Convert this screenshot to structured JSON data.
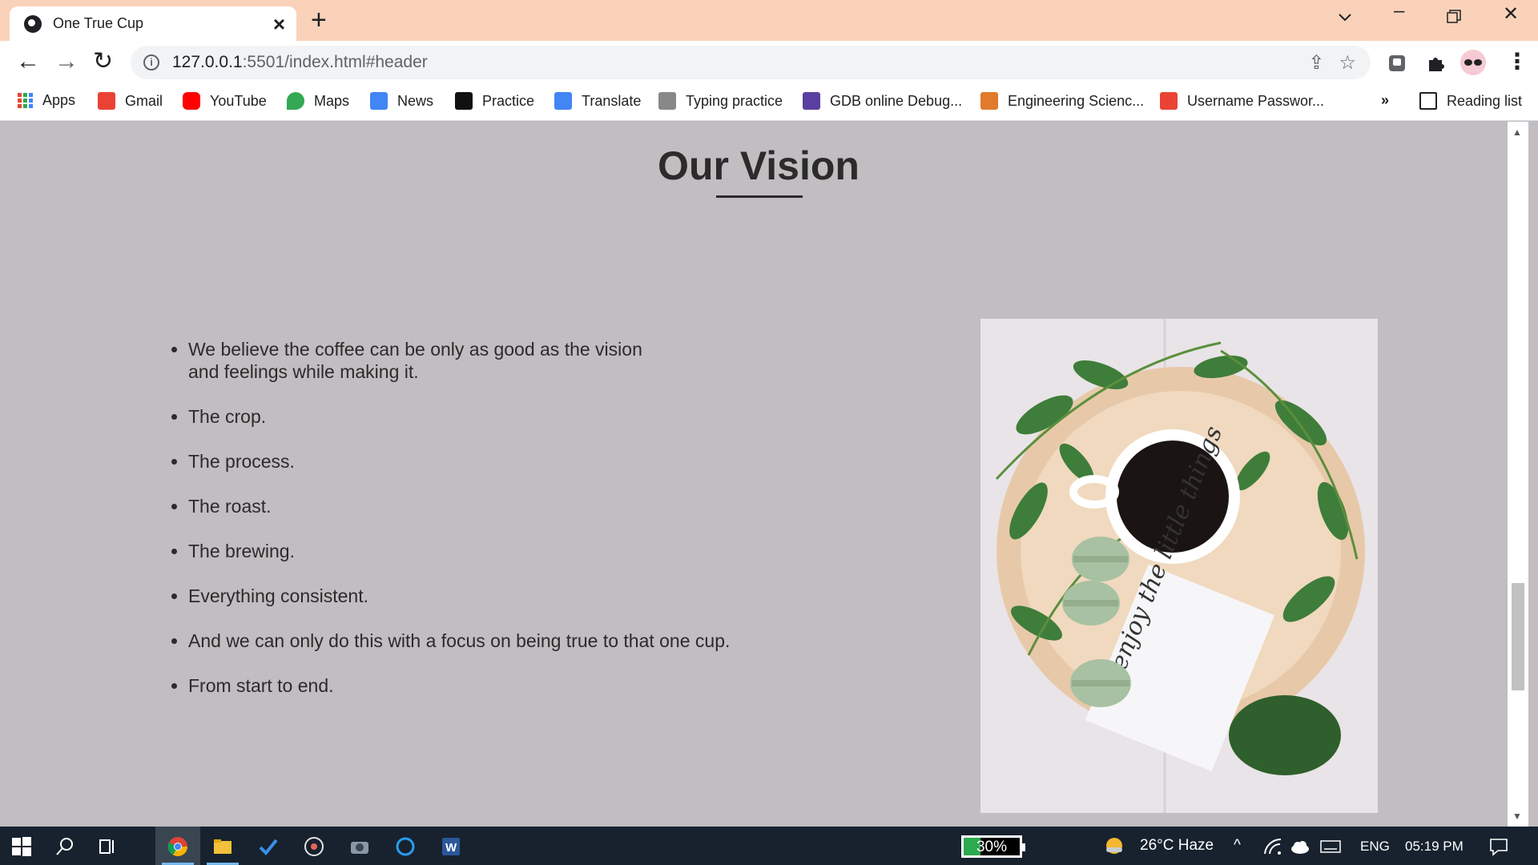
{
  "browser": {
    "tab_title": "One True Cup",
    "new_tab": "+",
    "url_host": "127.0.0.1",
    "url_rest": ":5501/index.html#header"
  },
  "bookmarks": [
    {
      "label": "Apps",
      "icon": "apps-grid-icon",
      "color": "#4285f4"
    },
    {
      "label": "Gmail",
      "icon": "gmail-icon",
      "color": "#ea4335"
    },
    {
      "label": "YouTube",
      "icon": "youtube-icon",
      "color": "#ff0000"
    },
    {
      "label": "Maps",
      "icon": "maps-icon",
      "color": "#34a853"
    },
    {
      "label": "News",
      "icon": "news-icon",
      "color": "#4285f4"
    },
    {
      "label": "Practice",
      "icon": "practice-icon",
      "color": "#111111"
    },
    {
      "label": "Translate",
      "icon": "translate-icon",
      "color": "#4285f4"
    },
    {
      "label": "Typing practice",
      "icon": "typing-icon",
      "color": "#888888"
    },
    {
      "label": "GDB online Debug...",
      "icon": "gdb-icon",
      "color": "#5b3fa0"
    },
    {
      "label": "Engineering Scienc...",
      "icon": "engineering-icon",
      "color": "#e07a2c"
    },
    {
      "label": "Username Passwor...",
      "icon": "gmail-icon",
      "color": "#ea4335"
    }
  ],
  "bookmarks_overflow": "»",
  "reading_list": "Reading list",
  "page": {
    "heading": "Our Vision",
    "items": [
      "We believe the coffee can be only as good as the vision and feelings while making it.",
      "The crop.",
      "The process.",
      "The roast.",
      "The brewing.",
      "Everything consistent.",
      "And we can only do this with a focus on being true to that one cup.",
      "From start to end."
    ],
    "note_text": "enjoy the little things"
  },
  "taskbar": {
    "battery": "30%",
    "weather": "26°C  Haze",
    "language": "ENG",
    "time": "05:19 PM"
  },
  "colors": {
    "page_bg": "#c1bdc1",
    "tabstrip_bg": "#fad2b9",
    "taskbar_bg": "#17222e"
  }
}
